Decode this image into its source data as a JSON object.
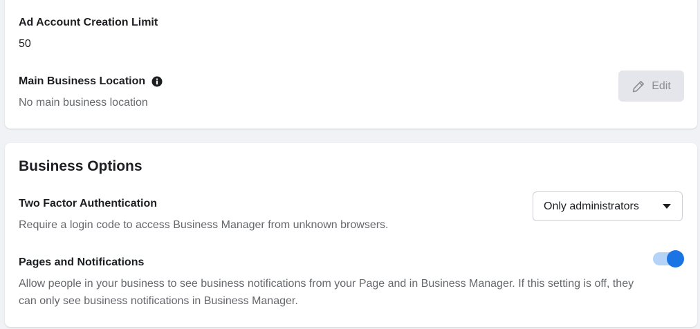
{
  "business_info": {
    "ad_account_limit": {
      "label": "Ad Account Creation Limit",
      "value": "50"
    },
    "main_location": {
      "label": "Main Business Location",
      "info_icon": "info-icon",
      "value": "No main business location",
      "edit_button": {
        "label": "Edit",
        "icon": "pencil-icon",
        "state": "disabled"
      }
    }
  },
  "business_options": {
    "title": "Business Options",
    "two_factor": {
      "label": "Two Factor Authentication",
      "description": "Require a login code to access Business Manager from unknown browsers.",
      "selected": "Only administrators"
    },
    "pages_notifications": {
      "label": "Pages and Notifications",
      "description": "Allow people in your business to see business notifications from your Page and in Business Manager. If this setting is off, they can only see business notifications in Business Manager.",
      "enabled": true
    }
  },
  "colors": {
    "page_background": "#f0f2f5",
    "card_background": "#ffffff",
    "accent": "#1b74e4",
    "toggle_track": "#b4d3f6",
    "secondary_text": "#65676b",
    "disabled_button": "#e4e6eb"
  }
}
